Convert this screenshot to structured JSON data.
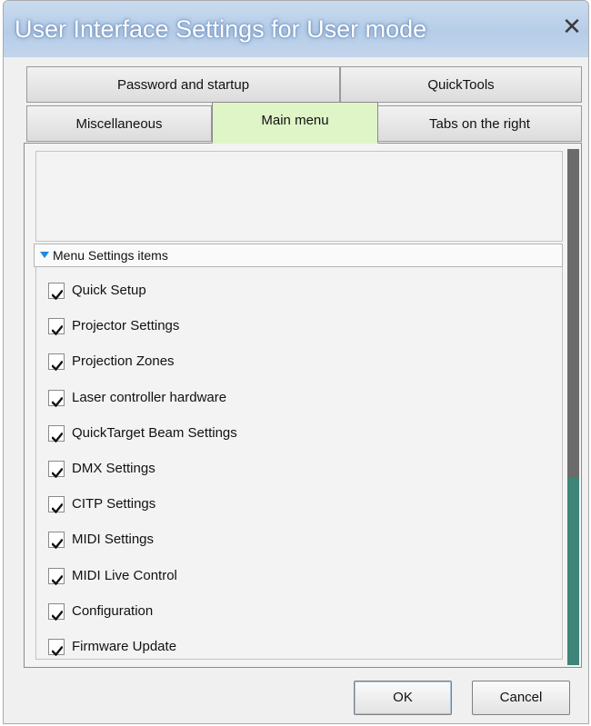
{
  "window": {
    "title": "User Interface Settings for User mode",
    "close_glyph": "✕"
  },
  "tabs": {
    "row1": [
      {
        "label": "Password and startup"
      },
      {
        "label": "QuickTools"
      }
    ],
    "row2": [
      {
        "label": "Miscellaneous"
      },
      {
        "label": "Main menu",
        "active": true
      },
      {
        "label": "Tabs on the right"
      }
    ]
  },
  "section": {
    "header": "Menu Settings items",
    "expand_icon": "triangle-down-icon",
    "items": [
      {
        "label": "Quick Setup",
        "checked": true
      },
      {
        "label": "Projector Settings",
        "checked": true
      },
      {
        "label": "Projection Zones",
        "checked": true
      },
      {
        "label": "Laser controller hardware",
        "checked": true
      },
      {
        "label": "QuickTarget Beam Settings",
        "checked": true
      },
      {
        "label": "DMX Settings",
        "checked": true
      },
      {
        "label": "CITP Settings",
        "checked": true
      },
      {
        "label": "MIDI Settings",
        "checked": true
      },
      {
        "label": "MIDI Live Control",
        "checked": true
      },
      {
        "label": "Configuration",
        "checked": true
      },
      {
        "label": "Firmware Update",
        "checked": true
      }
    ]
  },
  "buttons": {
    "ok": "OK",
    "cancel": "Cancel"
  },
  "colors": {
    "active_tab": "#dff5c8",
    "scroll_thumb": "#6b6b6b",
    "scroll_accent": "#3d8479",
    "expand_triangle": "#1e88e5"
  }
}
